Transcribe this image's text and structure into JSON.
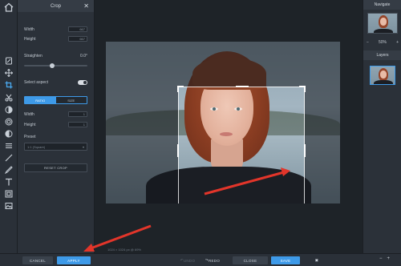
{
  "panel": {
    "title": "Crop",
    "width_label": "Width",
    "width_value": "667",
    "height_label": "Height",
    "height_value": "667",
    "straighten_label": "Straighten",
    "straighten_value": "0.0°",
    "select_aspect_label": "Select aspect",
    "select_aspect_on": true,
    "aspect_tabs": [
      "RATIO",
      "SIZE"
    ],
    "aspect_active_index": 0,
    "ratio_width_label": "Width",
    "ratio_width_value": "1",
    "ratio_height_label": "Height",
    "ratio_height_value": "1",
    "preset_label": "Preset",
    "preset_value": "1:1 (Square)",
    "reset_label": "RESET CROP"
  },
  "canvas": {
    "dimensions_text": "1024 × 1024 px @ 69%"
  },
  "right": {
    "navigate_title": "Navigate",
    "zoom_value": "50%",
    "layers_title": "Layers"
  },
  "bottom": {
    "cancel_label": "CANCEL",
    "apply_label": "APPLY",
    "undo_label": "UNDO",
    "redo_label": "REDO",
    "close_label": "CLOSE",
    "save_label": "SAVE"
  },
  "colors": {
    "accent": "#3e9ae8",
    "annotation_arrow": "#e2352a",
    "panel_bg": "#2b3139",
    "app_bg": "#1b1f24"
  },
  "icons": [
    "home-icon",
    "adjust-icon",
    "move-icon",
    "crop-icon",
    "cut-icon",
    "brightness-icon",
    "circle-icon",
    "contrast-icon",
    "layers-lines-icon",
    "brush-icon",
    "pen-icon",
    "text-icon",
    "frame-icon",
    "image-icon",
    "gear-icon",
    "close-icon",
    "minus-icon",
    "plus-icon",
    "fullscreen-icon"
  ]
}
